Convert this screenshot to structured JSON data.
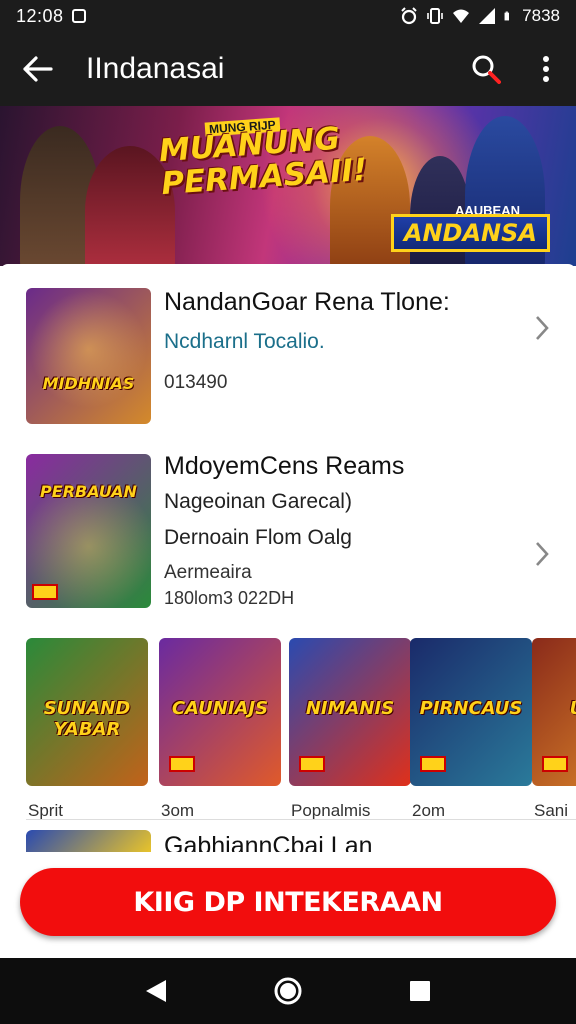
{
  "status_bar": {
    "time": "12:08",
    "battery_text": "7838",
    "icons": [
      "notification-icon",
      "alarm-icon",
      "vibrate-icon",
      "wifi-icon",
      "signal-icon",
      "battery-icon"
    ]
  },
  "app_bar": {
    "title": "IIndanasai",
    "icons": [
      "back-arrow-icon",
      "search-icon",
      "more-vert-icon"
    ]
  },
  "banner": {
    "small_tag": "MUNG RIJP",
    "title_line1": "MUANUNG",
    "title_line2": "PERMASAII!",
    "tag_top": "AAUBEAN",
    "tag": "ANDANSA"
  },
  "items": [
    {
      "name": "NandanGoar Rena Tlone:",
      "subtitle": "Ncdharnl Tocalio.",
      "meta": "013490",
      "thumb_logo": "MIDHNIAS",
      "thumb_colors": [
        "#6a2a8a",
        "#d48a2a"
      ]
    },
    {
      "name": "MdoyemCens Reams",
      "subtitle": "Nageoinan Garecal)",
      "line3": "Dernoain Flom Oalg",
      "meta1": "Aermeaira",
      "meta2": "180lom3 022DH",
      "thumb_logo": "PERBAUAN",
      "thumb_colors": [
        "#8a2aa0",
        "#2a8a3a"
      ]
    }
  ],
  "cards": [
    {
      "logo": "SUNAND YABAR",
      "label": "Sprit",
      "colors": [
        "#2a8a3a",
        "#c2621a"
      ]
    },
    {
      "logo": "CAUNIAJS",
      "label": "3om",
      "colors": [
        "#6a2aa0",
        "#e05a2a"
      ]
    },
    {
      "logo": "NIMANIS",
      "label": "Popnalmis",
      "colors": [
        "#2a4ab0",
        "#e0301a"
      ]
    },
    {
      "logo": "PIRNCAUS",
      "label": "2om",
      "colors": [
        "#1a2a6a",
        "#2a7a9a"
      ]
    },
    {
      "logo": "ULIR",
      "label": "Sani",
      "colors": [
        "#8a2a1a",
        "#e08a2a"
      ]
    }
  ],
  "partial_item": {
    "name": "GabhiannCbai Lan"
  },
  "cta": {
    "label": "KIIG DP INTEKERAAN"
  },
  "colors": {
    "bar_bg": "#1c1c1c",
    "cta_red": "#f20d0d",
    "teal_text": "#1b6f8a"
  }
}
